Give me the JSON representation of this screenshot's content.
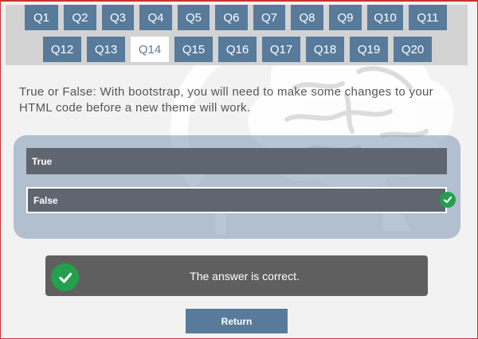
{
  "nav": {
    "row1": [
      "Q1",
      "Q2",
      "Q3",
      "Q4",
      "Q5",
      "Q6",
      "Q7",
      "Q8",
      "Q9",
      "Q10",
      "Q11"
    ],
    "row2": [
      "Q12",
      "Q13",
      "Q14",
      "Q15",
      "Q16",
      "Q17",
      "Q18",
      "Q19",
      "Q20"
    ],
    "active": "Q14"
  },
  "question": {
    "text": "True or False: With bootstrap, you will need to make some changes to your HTML code before a new theme will work."
  },
  "answers": {
    "options": [
      "True",
      "False"
    ],
    "selected": "False"
  },
  "feedback": {
    "text": "The answer is correct.",
    "status": "correct"
  },
  "return_label": "Return",
  "colors": {
    "accent": "#587a9b",
    "option_bg": "#5f6670",
    "correct": "#22a04b",
    "feedback_bg": "#5f5f5f",
    "panel_bg": "#d3d3d3",
    "border": "#c9302c"
  },
  "icons": {
    "correct": "check-circle-icon",
    "background": "brain-bulb-icon"
  }
}
